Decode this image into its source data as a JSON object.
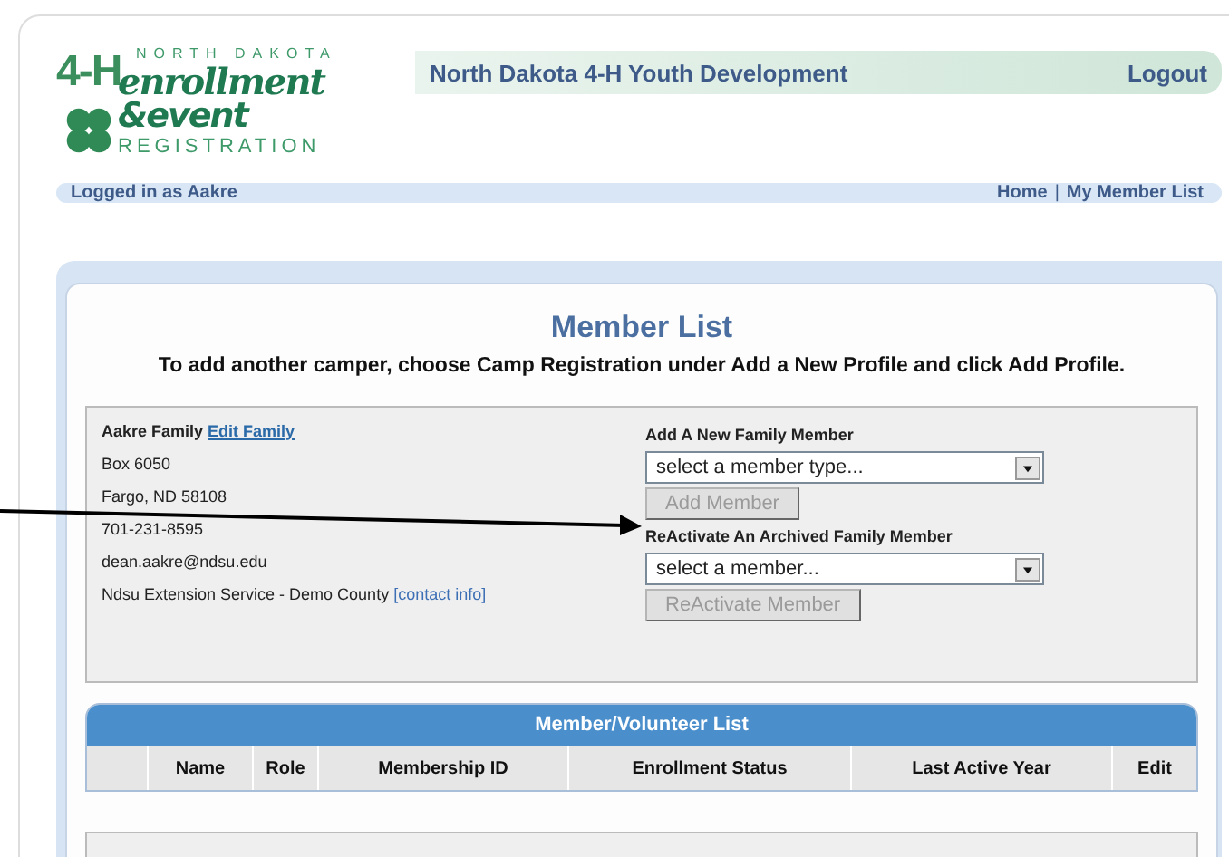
{
  "logo": {
    "state": "NORTH DAKOTA",
    "mark": "4-H",
    "line_1": "enrollment",
    "line_2": "&event",
    "line_3": "REGISTRATION"
  },
  "header": {
    "title": "North Dakota 4-H Youth Development",
    "logout": "Logout"
  },
  "info_bar": {
    "logged_in": "Logged in as Aakre",
    "links": [
      "Home",
      "My Member List"
    ],
    "separator": "|"
  },
  "page": {
    "title": "Member List",
    "instruction": "To add another camper, choose Camp Registration under Add a New Profile and click Add Profile."
  },
  "family": {
    "name": "Aakre Family",
    "edit_link": "Edit Family",
    "lines": [
      "Box 6050",
      "Fargo, ND 58108",
      "701-231-8595",
      "dean.aakre@ndsu.edu"
    ],
    "office": "Ndsu Extension Service - Demo County",
    "contact_link": "[contact info]"
  },
  "actions": [
    {
      "label": "Add A New Family Member",
      "dropdown": "select a member type...",
      "button": "Add Member",
      "disabled": true
    },
    {
      "label": "ReActivate An Archived Family Member",
      "dropdown": "select a member...",
      "button": "ReActivate Member",
      "disabled": true
    }
  ],
  "table": {
    "title": "Member/Volunteer List",
    "columns": [
      "",
      "Name",
      "Role",
      "Membership ID",
      "Enrollment Status",
      "Last Active Year",
      "Edit"
    ]
  }
}
